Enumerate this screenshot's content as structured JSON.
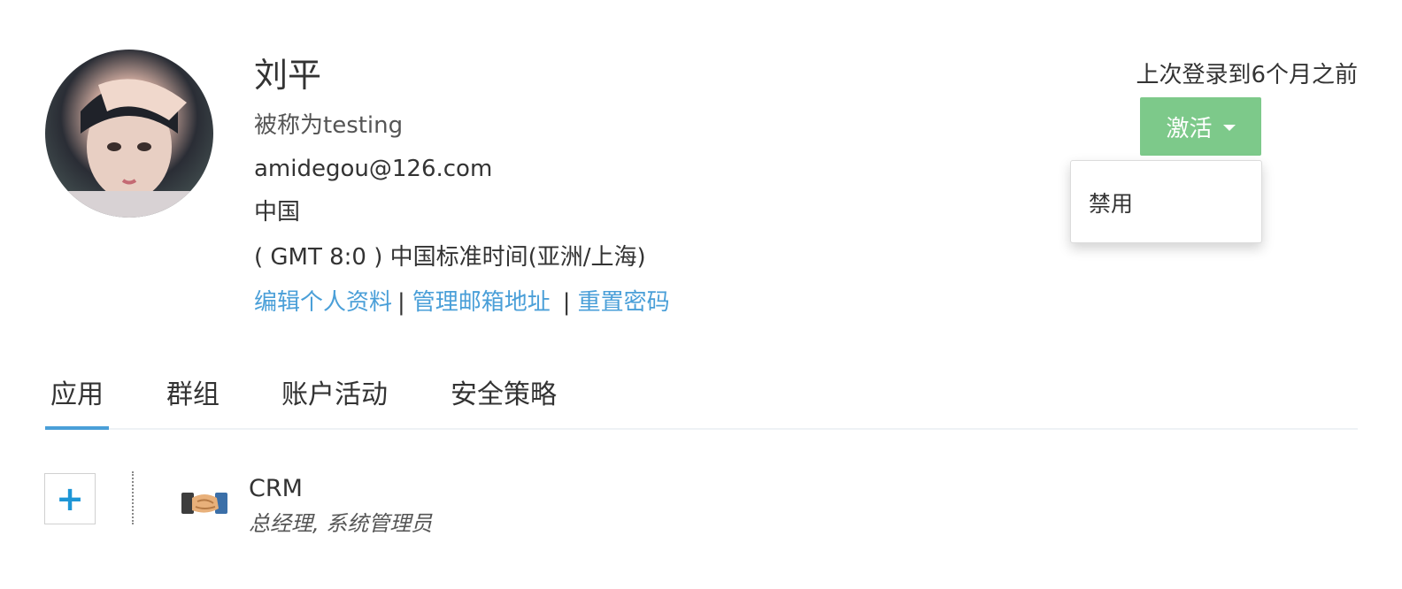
{
  "profile": {
    "name": "刘平",
    "nickname": "被称为testing",
    "email": "amidegou@126.com",
    "country": "中国",
    "timezone": "( GMT 8:0 ) 中国标准时间(亚洲/上海)",
    "links": {
      "edit_profile": "编辑个人资料",
      "sep1": "|",
      "manage_email": "管理邮箱地址",
      "sep2": "|",
      "reset_password": "重置密码"
    }
  },
  "status": {
    "last_login": "上次登录到6个月之前",
    "current": "激活",
    "button_color": "#7dc98a",
    "dropdown_items": [
      "禁用"
    ]
  },
  "tabs": [
    {
      "label": "应用",
      "active": true
    },
    {
      "label": "群组",
      "active": false
    },
    {
      "label": "账户活动",
      "active": false
    },
    {
      "label": "安全策略",
      "active": false
    }
  ],
  "apps": {
    "add_label": "+",
    "items": [
      {
        "name": "CRM",
        "roles": "总经理, 系统管理员",
        "icon": "handshake-icon"
      }
    ]
  },
  "colors": {
    "link": "#4a9fd8",
    "accent_tab": "#4a9fd8",
    "add_icon": "#1e96d6"
  }
}
